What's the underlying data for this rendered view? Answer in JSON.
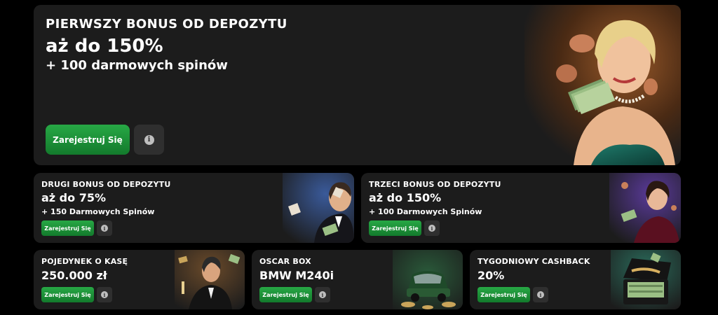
{
  "hero": {
    "title": "PIERWSZY BONUS OD DEPOZYTU",
    "amount": "aż do 150%",
    "extra": "+ 100 darmowych spinów",
    "cta": "Zarejestruj Się",
    "info_icon": "i"
  },
  "bonus2": {
    "title": "DRUGI BONUS OD DEPOZYTU",
    "amount": "aż do 75%",
    "extra": "+ 150 Darmowych Spinów",
    "cta": "Zarejestruj Się",
    "info_icon": "i"
  },
  "bonus3": {
    "title": "TRZECI BONUS OD DEPOZYTU",
    "amount": "aż do 150%",
    "extra": "+ 100 Darmowych Spinów",
    "cta": "Zarejestruj Się",
    "info_icon": "i"
  },
  "duel": {
    "title": "POJEDYNEK O KASĘ",
    "amount": "250.000 zł",
    "cta": "Zarejestruj Się",
    "info_icon": "i"
  },
  "oscar": {
    "title": "OSCAR BOX",
    "amount": "BMW M240i",
    "cta": "Zarejestruj Się",
    "info_icon": "i"
  },
  "cashback": {
    "title": "TYGODNIOWY CASHBACK",
    "amount": "20%",
    "cta": "Zarejestruj Się",
    "info_icon": "i"
  },
  "colors": {
    "page_bg": "#000000",
    "card_bg": "#1c1c1c",
    "cta_green": "#1e9a3a",
    "info_bg": "#2f2f2f"
  }
}
